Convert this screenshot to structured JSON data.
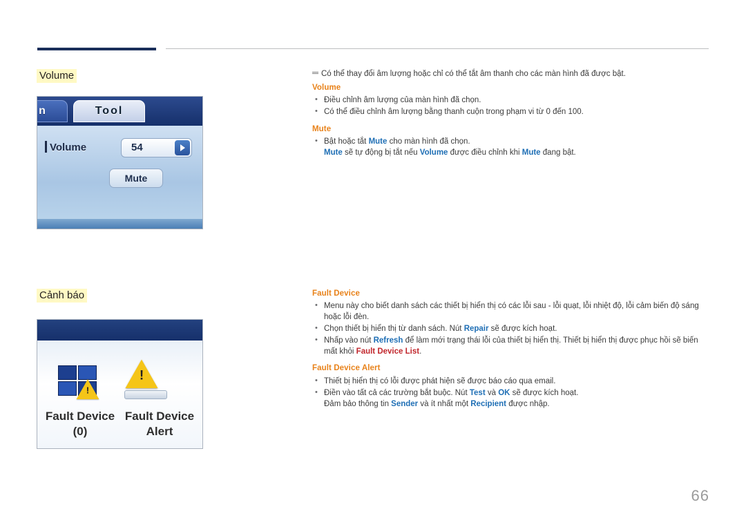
{
  "headings": {
    "volume": "Volume",
    "canh_bao": "Cảnh báo"
  },
  "figure_volume": {
    "tab_left": "n",
    "tab_active": "Tool",
    "row_label": "Volume",
    "row_value": "54",
    "mute_button": "Mute"
  },
  "figure_alert": {
    "caption_left_line1": "Fault Device",
    "caption_left_line2": "(0)",
    "caption_right_line1": "Fault Device",
    "caption_right_line2": "Alert"
  },
  "note": "Có thể thay đổi âm lượng hoặc chỉ có thể tắt âm thanh cho các màn hình đã được bật.",
  "sections": [
    {
      "title": "Volume",
      "bullets": [
        {
          "parts": [
            {
              "t": "Điều chỉnh âm lượng của màn hình đã chọn.",
              "s": "n"
            }
          ]
        },
        {
          "parts": [
            {
              "t": "Có thể điều chỉnh âm lượng bằng thanh cuộn trong phạm vi từ 0 đến 100.",
              "s": "n"
            }
          ]
        }
      ]
    },
    {
      "title": "Mute",
      "bullets": [
        {
          "parts": [
            {
              "t": "Bật hoặc tắt ",
              "s": "n"
            },
            {
              "t": "Mute",
              "s": "b"
            },
            {
              "t": " cho màn hình đã chọn.",
              "s": "n"
            }
          ],
          "sub": [
            {
              "t": "Mute",
              "s": "b"
            },
            {
              "t": " sẽ tự động bị tắt nếu ",
              "s": "n"
            },
            {
              "t": "Volume",
              "s": "b"
            },
            {
              "t": " được điều chỉnh khi ",
              "s": "n"
            },
            {
              "t": "Mute",
              "s": "b"
            },
            {
              "t": " đang bật.",
              "s": "n"
            }
          ]
        }
      ]
    },
    {
      "title": "Fault Device",
      "bullets": [
        {
          "parts": [
            {
              "t": "Menu này cho biết danh sách các thiết bị hiển thị có các lỗi sau - lỗi quạt, lỗi nhiệt độ, lỗi cảm biến độ sáng",
              "s": "n"
            }
          ],
          "sub": [
            {
              "t": "hoặc lỗi đèn.",
              "s": "n"
            }
          ]
        },
        {
          "parts": [
            {
              "t": "Chọn thiết bị hiển thị từ danh sách. Nút ",
              "s": "n"
            },
            {
              "t": "Repair",
              "s": "b"
            },
            {
              "t": " sẽ được kích hoạt.",
              "s": "n"
            }
          ]
        },
        {
          "parts": [
            {
              "t": "Nhấp vào nút ",
              "s": "n"
            },
            {
              "t": "Refresh",
              "s": "b"
            },
            {
              "t": " để làm mới trạng thái lỗi của thiết bị hiển thị. Thiết bị hiển thị được phục hồi sẽ biến",
              "s": "n"
            }
          ],
          "sub": [
            {
              "t": "mất khỏi ",
              "s": "n"
            },
            {
              "t": "Fault Device List",
              "s": "r"
            },
            {
              "t": ".",
              "s": "n"
            }
          ]
        }
      ]
    },
    {
      "title": "Fault Device Alert",
      "bullets": [
        {
          "parts": [
            {
              "t": "Thiết bị hiển thị có lỗi được phát hiện sẽ được báo cáo qua email.",
              "s": "n"
            }
          ]
        },
        {
          "parts": [
            {
              "t": "Điền vào tất cả các trường bắt buộc. Nút ",
              "s": "n"
            },
            {
              "t": "Test",
              "s": "b"
            },
            {
              "t": " và ",
              "s": "n"
            },
            {
              "t": "OK",
              "s": "b"
            },
            {
              "t": " sẽ được kích hoạt.",
              "s": "n"
            }
          ],
          "sub": [
            {
              "t": "Đảm bảo thông tin ",
              "s": "n"
            },
            {
              "t": "Sender",
              "s": "b"
            },
            {
              "t": " và ít nhất một ",
              "s": "n"
            },
            {
              "t": "Recipient",
              "s": "b"
            },
            {
              "t": " được nhập.",
              "s": "n"
            }
          ]
        }
      ]
    }
  ],
  "page_number": "66",
  "colors": {
    "heading_highlight": "#fff9c4",
    "subhead": "#e8821a",
    "keyword": "#1f6fb5",
    "keyword_red": "#c1272d",
    "rule_dark": "#1a2e5a"
  }
}
